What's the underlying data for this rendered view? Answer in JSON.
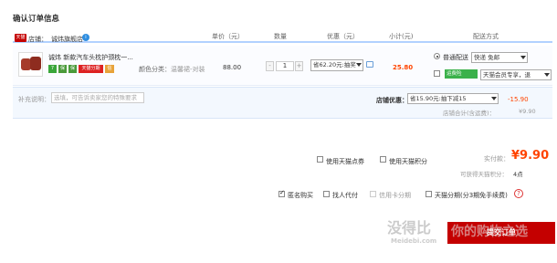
{
  "page": {
    "title": "确认订单信息"
  },
  "table_headers": {
    "price": "单价（元）",
    "quantity": "数量",
    "discount": "优惠（元）",
    "subtotal": "小计(元)",
    "shipping": "配送方式"
  },
  "shop": {
    "logo_text": "天猫",
    "label": "店铺：",
    "name": "诚炜旗舰店"
  },
  "item": {
    "name": "诚炜 新款汽车头枕护颈枕一...",
    "badges": [
      "7",
      "保",
      "天猫分期",
      "信"
    ],
    "attr_label": "颜色分类：",
    "attr_value": "温馨裙-对装",
    "price": "88.00",
    "quantity": "1",
    "minus": "-",
    "plus": "+",
    "discount_select": "省62.20元:抽奖",
    "subtotal": "25.80"
  },
  "shipping": {
    "option1_label": "普通配送",
    "option1_select": "快递 免邮",
    "option2_badge": "运费险",
    "option2_select": "天猫会员专享，退"
  },
  "memo": {
    "label": "补充说明：",
    "placeholder": "选填，可告诉卖家您的特殊要求"
  },
  "shop_promo": {
    "label": "店铺优惠：",
    "select": "省15.90元:抽下减15",
    "value": "-15.90",
    "total_label": "店铺合计(含运费)：",
    "total_value": "¥9.90"
  },
  "options": {
    "tmall_coupon": "使用天猫点券",
    "tmall_points": "使用天猫积分"
  },
  "payment": {
    "label": "实付款：",
    "amount": "¥9.90",
    "points_label": "可获得天猫积分：",
    "points_value": "4点"
  },
  "bottom": {
    "anonymous": "匿名购买",
    "proxy": "找人代付",
    "credit_card": "信用卡分期",
    "installment": "天猫分期(分3期免手续费)",
    "help": "?"
  },
  "submit": {
    "label": "提交订单"
  },
  "watermark": {
    "line1": "没得比",
    "line2": "Meidebi.com",
    "line3": "你的购物之选"
  }
}
